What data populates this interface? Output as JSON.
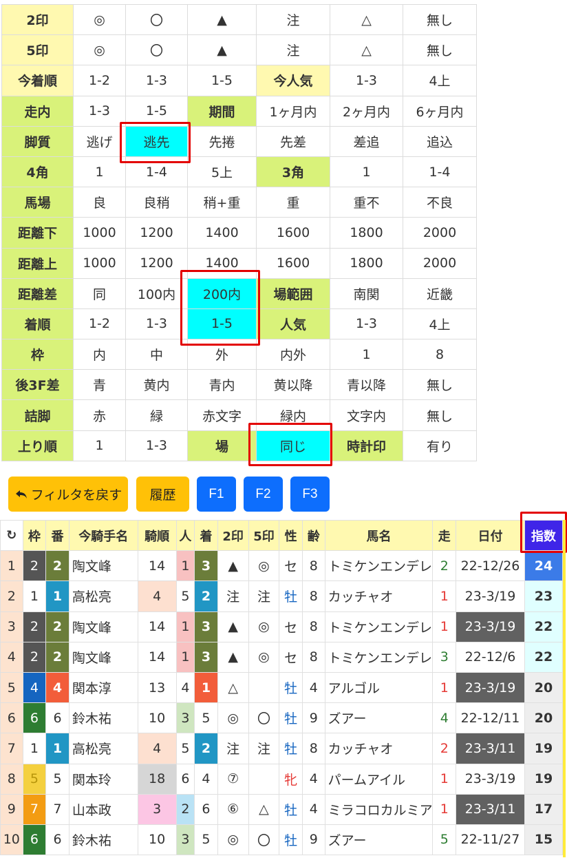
{
  "filter": {
    "rows": [
      {
        "cells": [
          {
            "t": "2印",
            "c": "y",
            "lbl": true
          },
          {
            "t": "◎"
          },
          {
            "t": "〇"
          },
          {
            "t": "▲"
          },
          {
            "t": "注"
          },
          {
            "t": "△"
          },
          {
            "t": "無し"
          }
        ]
      },
      {
        "cells": [
          {
            "t": "5印",
            "c": "y",
            "lbl": true
          },
          {
            "t": "◎"
          },
          {
            "t": "〇"
          },
          {
            "t": "▲"
          },
          {
            "t": "注"
          },
          {
            "t": "△"
          },
          {
            "t": "無し"
          }
        ]
      },
      {
        "cells": [
          {
            "t": "今着順",
            "c": "y",
            "lbl": true
          },
          {
            "t": "1-2"
          },
          {
            "t": "1-3"
          },
          {
            "t": "1-5"
          },
          {
            "t": "今人気",
            "c": "y",
            "lbl": true
          },
          {
            "t": "1-3"
          },
          {
            "t": "4上"
          }
        ]
      },
      {
        "cells": [
          {
            "t": "走内",
            "c": "g",
            "lbl": true
          },
          {
            "t": "1-3"
          },
          {
            "t": "1-5"
          },
          {
            "t": "期間",
            "c": "g",
            "lbl": true
          },
          {
            "t": "1ヶ月内"
          },
          {
            "t": "2ヶ月内"
          },
          {
            "t": "6ヶ月内"
          }
        ]
      },
      {
        "cells": [
          {
            "t": "脚質",
            "c": "g",
            "lbl": true
          },
          {
            "t": "逃げ"
          },
          {
            "t": "逃先",
            "c": "sel"
          },
          {
            "t": "先捲"
          },
          {
            "t": "先差"
          },
          {
            "t": "差追"
          },
          {
            "t": "追込"
          }
        ]
      },
      {
        "cells": [
          {
            "t": "4角",
            "c": "g",
            "lbl": true
          },
          {
            "t": "1"
          },
          {
            "t": "1-4"
          },
          {
            "t": "5上"
          },
          {
            "t": "3角",
            "c": "g",
            "lbl": true
          },
          {
            "t": "1"
          },
          {
            "t": "1-4"
          }
        ]
      },
      {
        "cells": [
          {
            "t": "馬場",
            "c": "g",
            "lbl": true
          },
          {
            "t": "良"
          },
          {
            "t": "良稍"
          },
          {
            "t": "稍+重"
          },
          {
            "t": "重"
          },
          {
            "t": "重不"
          },
          {
            "t": "不良"
          }
        ]
      },
      {
        "cells": [
          {
            "t": "距離下",
            "c": "g",
            "lbl": true
          },
          {
            "t": "1000"
          },
          {
            "t": "1200"
          },
          {
            "t": "1400"
          },
          {
            "t": "1600"
          },
          {
            "t": "1800"
          },
          {
            "t": "2000"
          }
        ]
      },
      {
        "cells": [
          {
            "t": "距離上",
            "c": "g",
            "lbl": true
          },
          {
            "t": "1000"
          },
          {
            "t": "1200"
          },
          {
            "t": "1400"
          },
          {
            "t": "1600"
          },
          {
            "t": "1800"
          },
          {
            "t": "2000"
          }
        ]
      },
      {
        "cells": [
          {
            "t": "距離差",
            "c": "g",
            "lbl": true
          },
          {
            "t": "同"
          },
          {
            "t": "100内"
          },
          {
            "t": "200内",
            "c": "sel"
          },
          {
            "t": "場範囲",
            "c": "g",
            "lbl": true
          },
          {
            "t": "南関"
          },
          {
            "t": "近畿"
          }
        ]
      },
      {
        "cells": [
          {
            "t": "着順",
            "c": "g",
            "lbl": true
          },
          {
            "t": "1-2"
          },
          {
            "t": "1-3"
          },
          {
            "t": "1-5",
            "c": "sel"
          },
          {
            "t": "人気",
            "c": "g",
            "lbl": true
          },
          {
            "t": "1-3"
          },
          {
            "t": "4上"
          }
        ]
      },
      {
        "cells": [
          {
            "t": "枠",
            "c": "g",
            "lbl": true
          },
          {
            "t": "内"
          },
          {
            "t": "中"
          },
          {
            "t": "外"
          },
          {
            "t": "内外"
          },
          {
            "t": "1"
          },
          {
            "t": "8"
          }
        ]
      },
      {
        "cells": [
          {
            "t": "後3F差",
            "c": "g",
            "lbl": true
          },
          {
            "t": "青"
          },
          {
            "t": "黄内"
          },
          {
            "t": "青内"
          },
          {
            "t": "黄以降"
          },
          {
            "t": "青以降"
          },
          {
            "t": "無し"
          }
        ]
      },
      {
        "cells": [
          {
            "t": "詰脚",
            "c": "g",
            "lbl": true
          },
          {
            "t": "赤"
          },
          {
            "t": "緑"
          },
          {
            "t": "赤文字"
          },
          {
            "t": "緑内"
          },
          {
            "t": "文字内"
          },
          {
            "t": "無し"
          }
        ]
      },
      {
        "cells": [
          {
            "t": "上り順",
            "c": "g",
            "lbl": true
          },
          {
            "t": "1"
          },
          {
            "t": "1-3"
          },
          {
            "t": "場",
            "c": "g",
            "lbl": true
          },
          {
            "t": "同じ",
            "c": "sel"
          },
          {
            "t": "時計印",
            "c": "g",
            "lbl": true
          },
          {
            "t": "有り"
          }
        ]
      }
    ]
  },
  "buttons": {
    "reset_label": "フィルタを戻す",
    "reset_icon": "undo-arrow-icon",
    "history_label": "履歴",
    "f1_label": "F1",
    "f2_label": "F2",
    "f3_label": "F3"
  },
  "results": {
    "refresh_icon": "↻",
    "headers": [
      "枠",
      "番",
      "今騎手名",
      "騎順",
      "人",
      "着",
      "2印",
      "5印",
      "性",
      "齢",
      "馬名",
      "走",
      "日付",
      "指数"
    ],
    "rows": [
      {
        "no": "1",
        "waku": "2",
        "ban": "2",
        "jockey": "陶文峰",
        "kijun": "14",
        "ninki": "1",
        "chaku": "3",
        "m2": "▲",
        "m5": "◎",
        "sex": "セ",
        "age": "8",
        "horse": "トミケンエンデレア",
        "run": "2",
        "date": "22-12/26",
        "score": "24"
      },
      {
        "no": "2",
        "waku": "1",
        "ban": "1",
        "jockey": "高松亮",
        "kijun": "4",
        "ninki": "5",
        "chaku": "2",
        "m2": "注",
        "m5": "注",
        "sex": "牡",
        "age": "8",
        "horse": "カッチャオ",
        "run": "1",
        "date": "23-3/19",
        "score": "23"
      },
      {
        "no": "3",
        "waku": "2",
        "ban": "2",
        "jockey": "陶文峰",
        "kijun": "14",
        "ninki": "1",
        "chaku": "3",
        "m2": "▲",
        "m5": "◎",
        "sex": "セ",
        "age": "8",
        "horse": "トミケンエンデレア",
        "run": "1",
        "date": "23-3/19",
        "score": "22"
      },
      {
        "no": "4",
        "waku": "2",
        "ban": "2",
        "jockey": "陶文峰",
        "kijun": "14",
        "ninki": "1",
        "chaku": "3",
        "m2": "▲",
        "m5": "◎",
        "sex": "セ",
        "age": "8",
        "horse": "トミケンエンデレア",
        "run": "3",
        "date": "22-12/6",
        "score": "22"
      },
      {
        "no": "5",
        "waku": "4",
        "ban": "4",
        "jockey": "関本淳",
        "kijun": "13",
        "ninki": "4",
        "chaku": "1",
        "m2": "△",
        "m5": "",
        "sex": "牡",
        "age": "4",
        "horse": "アルゴル",
        "run": "1",
        "date": "23-3/19",
        "score": "20"
      },
      {
        "no": "6",
        "waku": "6",
        "ban": "6",
        "jockey": "鈴木祐",
        "kijun": "10",
        "ninki": "3",
        "chaku": "5",
        "m2": "◎",
        "m5": "〇",
        "sex": "牡",
        "age": "9",
        "horse": "ズアー",
        "run": "4",
        "date": "22-12/11",
        "score": "20"
      },
      {
        "no": "7",
        "waku": "1",
        "ban": "1",
        "jockey": "高松亮",
        "kijun": "4",
        "ninki": "5",
        "chaku": "2",
        "m2": "注",
        "m5": "注",
        "sex": "牡",
        "age": "8",
        "horse": "カッチャオ",
        "run": "2",
        "date": "23-3/11",
        "score": "19"
      },
      {
        "no": "8",
        "waku": "5",
        "ban": "5",
        "jockey": "関本玲",
        "kijun": "18",
        "ninki": "6",
        "chaku": "4",
        "m2": "⑦",
        "m5": "",
        "sex": "牝",
        "age": "4",
        "horse": "パームアイル",
        "run": "1",
        "date": "23-3/19",
        "score": "19"
      },
      {
        "no": "9",
        "waku": "7",
        "ban": "7",
        "jockey": "山本政",
        "kijun": "3",
        "ninki": "2",
        "chaku": "6",
        "m2": "⑥",
        "m5": "△",
        "sex": "牡",
        "age": "4",
        "horse": "ミラコロカルミア",
        "run": "1",
        "date": "23-3/11",
        "score": "17"
      },
      {
        "no": "10",
        "waku": "6",
        "ban": "6",
        "jockey": "鈴木祐",
        "kijun": "10",
        "ninki": "3",
        "chaku": "5",
        "m2": "◎",
        "m5": "〇",
        "sex": "牡",
        "age": "9",
        "horse": "ズアー",
        "run": "5",
        "date": "22-11/27",
        "score": "15"
      }
    ]
  },
  "colors": {
    "yellow_label": "#fff9b0",
    "green_label": "#d9f27a",
    "selected": "#00ffff",
    "highlight_border": "#e30000",
    "waku_2": "#555555",
    "waku_1": "#ffffff",
    "waku_4": "#1565c0",
    "waku_6": "#2e7d32",
    "waku_5": "#f4d03f",
    "waku_7": "#f39c12"
  }
}
